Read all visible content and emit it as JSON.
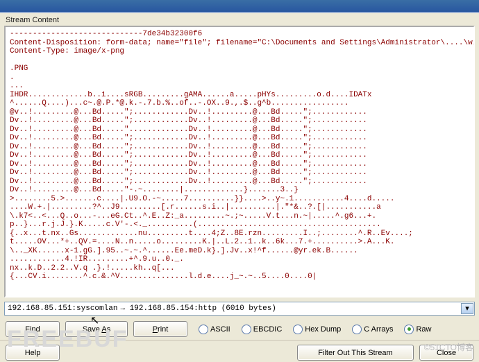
{
  "section": {
    "label": "Stream Content"
  },
  "stream": {
    "text": "-----------------------------7de34b32300f6\nContent-Disposition: form-data; name=\"file\"; filename=\"C:\\Documents and Settings\\Administrator\\....\\wireshark\\bingo.png\"\nContent-Type: image/x-png\n\n.PNG\n.\n...\nIHDR.............b..i....sRGB.........gAMA......a.....pHYs.........o.d....IDATx\n^......Q....)...c~.@.P.*@.k.-.7.b.%..of..-.OX..9.,.$..g^b.................\n@v..!.........@...Bd.....\";............Dv..!.........@...Bd.....\";............\nDv..!.........@...Bd.....\";............Dv..!.........@...Bd.....\";............\nDv..!.........@...Bd.....\".............Dv..!.........@...Bd.....\";............\nDv..!.........@...Bd.....\";............Dv..!.........@...Bd.....\";............\nDv..!.........@...Bd.....\";............Dv..!.........@...Bd.....\";............\nDv..!.........@...Bd.....\";............Dv..!.........@...Bd.....\";............\nDv..!.........@...Bd.....\";............Dv..!.........@...Bd.....\";............\nDv..!.........@...Bd.....\";............Dv..!.........@...Bd.....\";............\nDv..!.........@...Bd.....\";............Dv..!.........@...Bd.....\";............\nDv..!.........@...Bd.....\"-.~........|.............}.......3..}\n>........5.>.......c....|.U9.O.-~.....7..........}}....>..y~.1...........4....d.....\n....W.+.|.........?^..J9.........[.r......s.i..|..........|.\"*&..?.[|...........a\n\\.k7<..<...Q..o...-...eG.Ct..^.E..Z:_a.........~.;~.....V.t...n.~|.....^.g6...+.\np..}...r.j.J.}.K.....c.V'-.<._..........(........................................\n{..x...t.nx..Gs.............nu.........t....4;Z..8E.rzn.........I..;........^.R..Ev....;\nt.....OV...*+..QV.=....N..n.....o.........K.|..L.2..1..k..6k...7.+..........>.A...K.\n\\.._XK......x-1.gG.].95..~.~.^......Ee.meD.k}.].Jv..x!^f......@yr.ek.B......\n............4.!IR.........+^.9.u..0._.\nnx..k.D..2.2..V.q .}.!.....kh..q[...\n{...CV.i........^.c.&.^V...............l.d.e....j_~.~..5....0....0|"
  },
  "dropdown": {
    "src": "192.168.85.151:syscomlan",
    "arrow": "→",
    "dst": "192.168.85.154:http",
    "bytes": "(6010 bytes)"
  },
  "buttons": {
    "find": "Find",
    "find_u": "F",
    "saveas": "Save As",
    "saveas_u": "A",
    "print": "Print",
    "print_u": "P",
    "help": "Help",
    "close": "Close",
    "filter": "Filter Out This Stream"
  },
  "radios": {
    "ascii": "ASCII",
    "ebcdic": "EBCDIC",
    "hexdump": "Hex Dump",
    "carrays": "C Arrays",
    "raw": "Raw"
  },
  "watermark": {
    "main": "FREEBUF",
    "right": "©51CTO博客"
  }
}
